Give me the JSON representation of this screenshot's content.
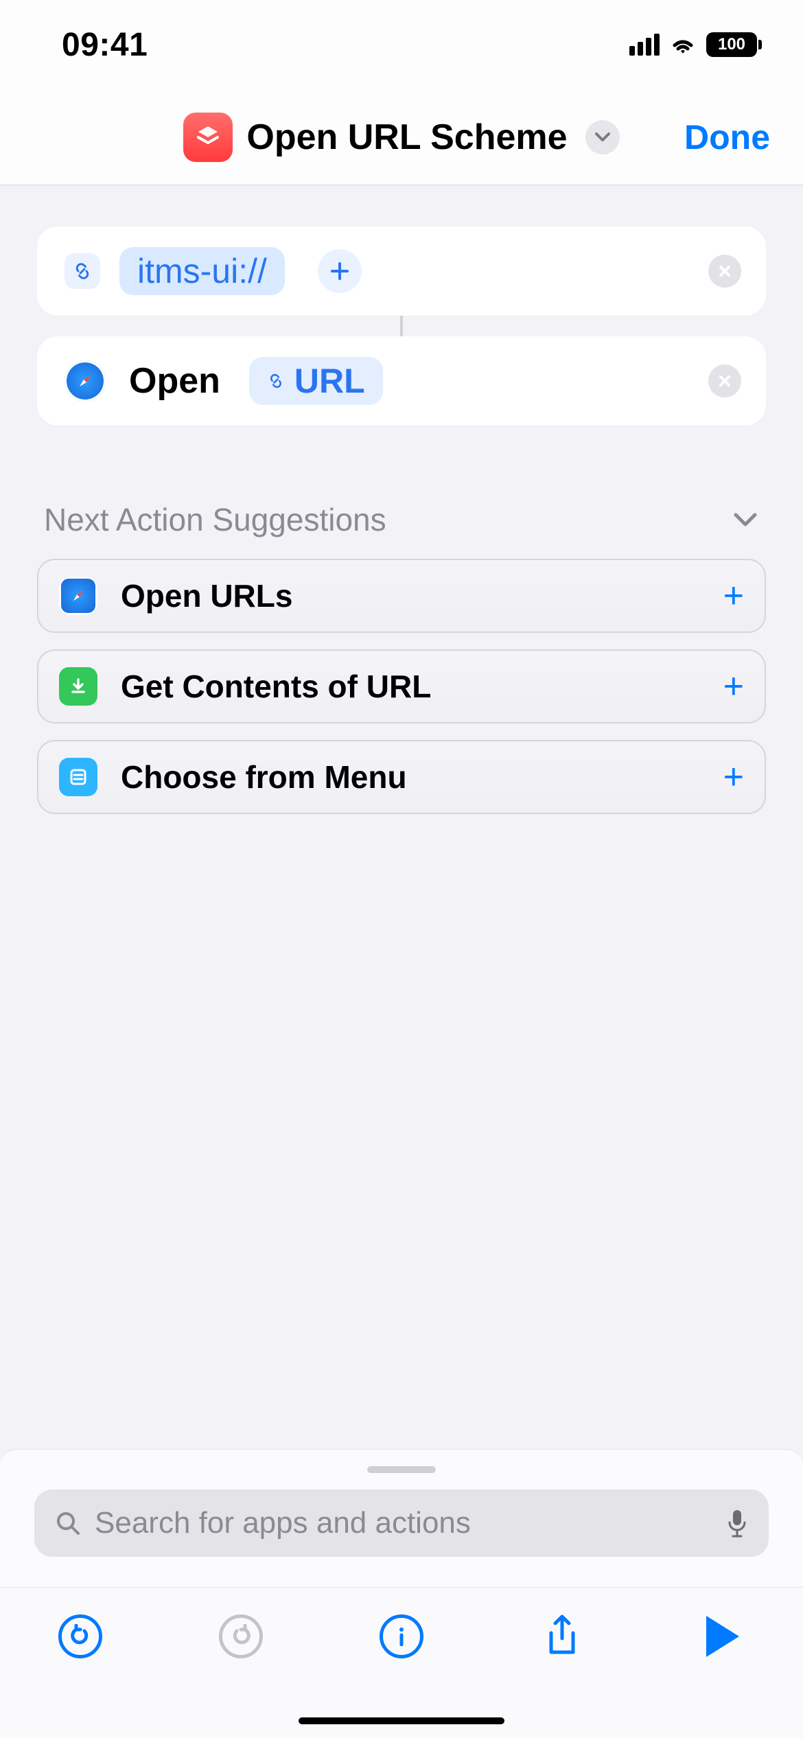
{
  "status": {
    "time": "09:41",
    "battery": "100"
  },
  "nav": {
    "title": "Open URL Scheme",
    "done": "Done"
  },
  "action1": {
    "url_token": "itms-ui://"
  },
  "action2": {
    "label": "Open",
    "param_token": "URL"
  },
  "suggestions": {
    "header": "Next Action Suggestions",
    "items": [
      {
        "label": "Open URLs"
      },
      {
        "label": "Get Contents of URL"
      },
      {
        "label": "Choose from Menu"
      }
    ]
  },
  "search": {
    "placeholder": "Search for apps and actions"
  }
}
